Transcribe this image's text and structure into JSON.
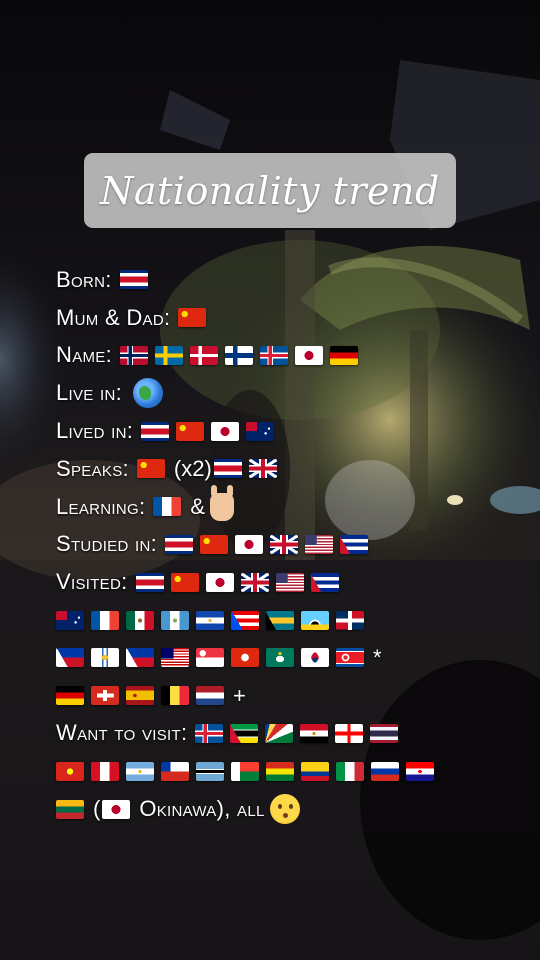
{
  "title": "Nationality trend",
  "rows": [
    {
      "label": "Born:",
      "items": [
        {
          "flag": "costa-rica"
        }
      ]
    },
    {
      "label": "Mum & Dad:",
      "items": [
        {
          "flag": "china"
        }
      ]
    },
    {
      "label": "Name:",
      "items": [
        {
          "flag": "norway"
        },
        {
          "flag": "sweden"
        },
        {
          "flag": "denmark"
        },
        {
          "flag": "finland"
        },
        {
          "flag": "iceland"
        },
        {
          "flag": "japan"
        },
        {
          "flag": "germany"
        }
      ]
    },
    {
      "label": "Live in:",
      "items": [
        {
          "emoji": "globe-icon"
        }
      ]
    },
    {
      "label": "Lived in:",
      "items": [
        {
          "flag": "costa-rica"
        },
        {
          "flag": "china"
        },
        {
          "flag": "japan"
        },
        {
          "flag": "australia"
        }
      ]
    },
    {
      "label": "Speaks:",
      "items": [
        {
          "flag": "china"
        },
        {
          "text": "(x2)"
        },
        {
          "flag": "costa-rica"
        },
        {
          "flag": "uk"
        }
      ]
    },
    {
      "label": "Learning:",
      "items": [
        {
          "flag": "france"
        },
        {
          "text": "&"
        },
        {
          "emoji": "sign-language-hand-icon"
        }
      ]
    },
    {
      "label": "Studied in:",
      "items": [
        {
          "flag": "costa-rica"
        },
        {
          "flag": "china"
        },
        {
          "flag": "japan"
        },
        {
          "flag": "uk"
        },
        {
          "flag": "usa"
        },
        {
          "flag": "cuba"
        }
      ]
    },
    {
      "label": "Visited:",
      "items": [
        {
          "flag": "costa-rica"
        },
        {
          "flag": "china"
        },
        {
          "flag": "japan"
        },
        {
          "flag": "uk"
        },
        {
          "flag": "usa"
        },
        {
          "flag": "cuba"
        }
      ]
    },
    {
      "label": "",
      "items": [
        {
          "flag": "australia"
        },
        {
          "flag": "france"
        },
        {
          "flag": "mexico"
        },
        {
          "flag": "guatemala"
        },
        {
          "flag": "el-salvador"
        },
        {
          "flag": "puerto-rico"
        },
        {
          "flag": "bahamas"
        },
        {
          "flag": "saint-lucia"
        },
        {
          "flag": "dominican-republic"
        }
      ]
    },
    {
      "label": "",
      "items": [
        {
          "flag": "philippines"
        },
        {
          "flag": "us-virgin-islands"
        },
        {
          "flag": "philippines"
        },
        {
          "flag": "malaysia"
        },
        {
          "flag": "singapore"
        },
        {
          "flag": "hong-kong"
        },
        {
          "flag": "macau"
        },
        {
          "flag": "south-korea"
        },
        {
          "flag": "north-korea"
        },
        {
          "text": "*"
        }
      ]
    },
    {
      "label": "",
      "items": [
        {
          "flag": "germany"
        },
        {
          "flag": "switzerland"
        },
        {
          "flag": "spain"
        },
        {
          "flag": "belgium"
        },
        {
          "flag": "netherlands"
        },
        {
          "text": "+"
        }
      ]
    },
    {
      "label": "Want to visit:",
      "items": [
        {
          "flag": "iceland"
        },
        {
          "flag": "mozambique"
        },
        {
          "flag": "seychelles"
        },
        {
          "flag": "egypt"
        },
        {
          "flag": "georgia"
        },
        {
          "flag": "thailand"
        }
      ]
    },
    {
      "label": "",
      "items": [
        {
          "flag": "vietnam"
        },
        {
          "flag": "peru"
        },
        {
          "flag": "argentina"
        },
        {
          "flag": "chile"
        },
        {
          "flag": "botswana"
        },
        {
          "flag": "madagascar"
        },
        {
          "flag": "bolivia"
        },
        {
          "flag": "colombia"
        },
        {
          "flag": "italy"
        },
        {
          "flag": "russia"
        },
        {
          "flag": "croatia"
        }
      ]
    },
    {
      "label": "",
      "items": [
        {
          "flag": "lithuania"
        },
        {
          "text": "("
        },
        {
          "flag": "japan"
        },
        {
          "text": "Okinawa), all"
        },
        {
          "emoji": "kissing-face-icon"
        }
      ]
    }
  ],
  "flag_styles": {
    "costa-rica": "linear-gradient(#002b7f 0 16%, #fff 16% 33%, #ce1126 33% 67%, #fff 67% 84%, #002b7f 84%)",
    "china": "radial-gradient(circle at 24% 32%, #ffde00 0 12%, transparent 13%), #de2910",
    "norway": "linear-gradient(to right, transparent 30%, #00205b 30% 42%, transparent 42%), linear-gradient(transparent 42%, #00205b 42% 58%, transparent 58%), linear-gradient(to right, transparent 26%, #fff 26% 46%, transparent 46%), linear-gradient(transparent 34%, #fff 34% 66%, transparent 66%), #ba0c2f",
    "sweden": "linear-gradient(to right, transparent 30%, #fecc00 30% 44%, transparent 44%), linear-gradient(transparent 40%, #fecc00 40% 60%, transparent 60%), #006aa7",
    "denmark": "linear-gradient(to right, transparent 30%, #fff 30% 42%, transparent 42%), linear-gradient(transparent 42%, #fff 42% 58%, transparent 58%), #c8102e",
    "finland": "linear-gradient(to right, transparent 28%, #003580 28% 44%, transparent 44%), linear-gradient(transparent 38%, #003580 38% 62%, transparent 62%), #ffffff",
    "iceland": "linear-gradient(to right, transparent 30%, #dc1e35 30% 42%, transparent 42%), linear-gradient(transparent 42%, #dc1e35 42% 58%, transparent 58%), linear-gradient(to right, transparent 26%, #fff 26% 46%, transparent 46%), linear-gradient(transparent 34%, #fff 34% 66%, transparent 66%), #02529c",
    "japan": "radial-gradient(circle at 50% 50%, #bc002d 0 26%, #ffffff 27%)",
    "germany": "linear-gradient(#000 0 33%, #dd0000 33% 66%, #ffce00 66%)",
    "australia": "radial-gradient(circle at 70% 60%, #fff 0 5%, transparent 6%), radial-gradient(circle at 82% 35%, #fff 0 4%, transparent 5%), linear-gradient(#c8102e, #c8102e) 0 0/40% 48% no-repeat, #012169",
    "uk": "linear-gradient(to right, transparent 42%, #c8102e 42% 58%, transparent 58%), linear-gradient(transparent 40%, #c8102e 40% 60%, transparent 60%), linear-gradient(to right, transparent 36%, #fff 36% 64%, transparent 64%), linear-gradient(transparent 32%, #fff 32% 68%, transparent 68%), linear-gradient(33deg, transparent 45%, #fff 45% 55%, transparent 55%), linear-gradient(-33deg, transparent 45%, #fff 45% 55%, transparent 55%), #012169",
    "france": "linear-gradient(to right, #0055a4 0 33%, #fff 33% 66%, #ef4135 66%)",
    "usa": "linear-gradient(#3c3b6e, #3c3b6e) 0 0/42% 54% no-repeat, repeating-linear-gradient(#b22234 0 7.7%, #fff 7.7% 15.4%)",
    "cuba": "linear-gradient(60deg, #cf142b 0 26%, transparent 26%), linear-gradient(120deg, transparent 74%, transparent 74%), repeating-linear-gradient(#002a8f 0 20%, #fff 20% 40%)",
    "mexico": "radial-gradient(circle at 50% 50%, #8a6a2c 0 12%, transparent 13%), linear-gradient(to right, #006847 0 33%, #fff 33% 66%, #ce1126 66%)",
    "guatemala": "radial-gradient(circle at 50% 50%, #7fae5a 0 12%, transparent 13%), linear-gradient(to right, #4997d0 0 33%, #fff 33% 66%, #4997d0 66%)",
    "el-salvador": "radial-gradient(circle at 50% 50%, #e4c04a 0 10%, transparent 11%), linear-gradient(#0f47af 0 33%, #fff 33% 66%, #0f47af 66%)",
    "puerto-rico": "linear-gradient(60deg, #0050f0 0 30%, transparent 30%), repeating-linear-gradient(#ed0000 0 20%, #fff 20% 40%)",
    "bahamas": "linear-gradient(60deg, #000 0 26%, transparent 26%), linear-gradient(#00778b 0 33%, #ffc72c 33% 66%, #00778b 66%)",
    "saint-lucia": "linear-gradient(to top, #fcd116 0 28%, transparent 28%), radial-gradient(ellipse at 50% 80%, #000 0 22%, transparent 23%), radial-gradient(ellipse at 50% 80%, #fff 0 30%, transparent 31%), #65cfff",
    "dominican-republic": "linear-gradient(to right, transparent 43%, #fff 43% 57%, transparent 57%), linear-gradient(transparent 40%, #fff 40% 60%, transparent 60%), linear-gradient(to right, #002d62 0 50%, #ce1126 50%) top/100% 50% no-repeat, linear-gradient(to right, #ce1126 0 50%, #002d62 50%) bottom/100% 50% no-repeat",
    "philippines": "linear-gradient(60deg, #fff 0 30%, transparent 30%), linear-gradient(#0038a8 0 50%, #ce1126 50%)",
    "us-virgin-islands": "radial-gradient(ellipse at 50% 50%, #f4c430 0 18%, transparent 19%), linear-gradient(to right, #fff 0 40%, #2a6bb0 40% 44%, #fff 44% 56%, #2a6bb0 56% 60%, #fff 60%)",
    "malaysia": "linear-gradient(#010066, #010066) 0 0/45% 56% no-repeat, repeating-linear-gradient(#cc0001 0 7.1%, #fff 7.1% 14.2%)",
    "singapore": "radial-gradient(circle at 24% 28%, #fff 0 12%, transparent 13%), linear-gradient(#ef3340 0 50%, #fff 50%)",
    "hong-kong": "radial-gradient(circle at 50% 50%, #fff 0 22%, transparent 23%), #de2910",
    "macau": "radial-gradient(ellipse at 50% 58%, #fff 0 20%, transparent 21%), radial-gradient(circle at 50% 30%, #fbd116 0 8%, transparent 9%), #00785e",
    "south-korea": "radial-gradient(circle at 50% 38%, #c60c30 0 14%, transparent 15%), radial-gradient(circle at 50% 62%, #003478 0 14%, transparent 15%), radial-gradient(circle at 50% 50%, #c60c30 0 22%, transparent 23%), #ffffff",
    "north-korea": "radial-gradient(circle at 34% 50%, #ed1c27 0 10%, #fff 11% 18%, transparent 19%), linear-gradient(#024fa2 0 16%, #fff 16% 20%, #ed1c27 20% 80%, #fff 80% 84%, #024fa2 84%)",
    "switzerland": "linear-gradient(to right, transparent 42%, #fff 42% 58%, transparent 58%) center/100% 60% no-repeat, linear-gradient(transparent 40%, #fff 40% 60%, transparent 60%) center/60% 100% no-repeat, #d52b1e",
    "spain": "radial-gradient(circle at 32% 50%, #ad1519 0 8%, transparent 9%), linear-gradient(#aa151b 0 25%, #f1bf00 25% 75%, #aa151b 75%)",
    "belgium": "linear-gradient(to right, #000 0 33%, #fae042 33% 66%, #ed2939 66%)",
    "netherlands": "linear-gradient(#ae1c28 0 33%, #fff 33% 66%, #21468b 66%)",
    "mozambique": "linear-gradient(60deg, #d21034 0 28%, transparent 28%), linear-gradient(#009a44 0 30%, #fff 30% 34%, #000 34% 66%, #fff 66% 70%, #fce100 70%)",
    "seychelles": "conic-gradient(from 0deg at 0% 100%, #003f87 0 14deg, #fcd856 14deg 30deg, #d62828 30deg 50deg, #fff 50deg 68deg, #007a3d 68deg 90deg)",
    "egypt": "radial-gradient(circle at 50% 50%, #c09300 0 9%, transparent 10%), linear-gradient(#ce1126 0 33%, #fff 33% 66%, #000 66%)",
    "georgia": "linear-gradient(to right, transparent 44%, #ff0000 44% 56%, transparent 56%), linear-gradient(transparent 40%, #ff0000 40% 60%, transparent 60%), #ffffff",
    "thailand": "linear-gradient(#a51931 0 16%, #f4f5f8 16% 33%, #2d2a4a 33% 67%, #f4f5f8 67% 84%, #a51931 84%)",
    "vietnam": "radial-gradient(circle at 50% 50%, #ffff00 0 18%, transparent 19%), #da251d",
    "peru": "linear-gradient(to right, #d91023 0 33%, #fff 33% 66%, #d91023 66%)",
    "argentina": "radial-gradient(circle at 50% 50%, #f6b40e 0 9%, transparent 10%), linear-gradient(#74acdf 0 33%, #fff 33% 66%, #74acdf 66%)",
    "chile": "linear-gradient(#0039a6, #0039a6) 0 0/34% 50% no-repeat, linear-gradient(#fff 0 50%, #d52b1e 50%)",
    "botswana": "linear-gradient(#6da9d2 0 38%, #fff 38% 42%, #000 42% 58%, #fff 58% 62%, #6da9d2 62%)",
    "madagascar": "linear-gradient(to right, #fff 0 33%, transparent 33%), linear-gradient(#fc3d32 0 50%, #007e3a 50%)",
    "bolivia": "linear-gradient(#d52b1e 0 33%, #f9e300 33% 66%, #007934 66%)",
    "colombia": "linear-gradient(#fcd116 0 50%, #003893 50% 75%, #ce1126 75%)",
    "italy": "linear-gradient(to right, #009246 0 33%, #fff 33% 66%, #ce2b37 66%)",
    "russia": "linear-gradient(#fff 0 33%, #0039a6 33% 66%, #d52b1e 66%)",
    "croatia": "radial-gradient(ellipse at 50% 50%, #ff0000 0 10%, #fff 11% 14%, transparent 15%), linear-gradient(#ff0000 0 33%, #fff 33% 66%, #171796 66%)",
    "lithuania": "linear-gradient(#fdb913 0 33%, #006a44 33% 66%, #c1272d 66%)"
  }
}
